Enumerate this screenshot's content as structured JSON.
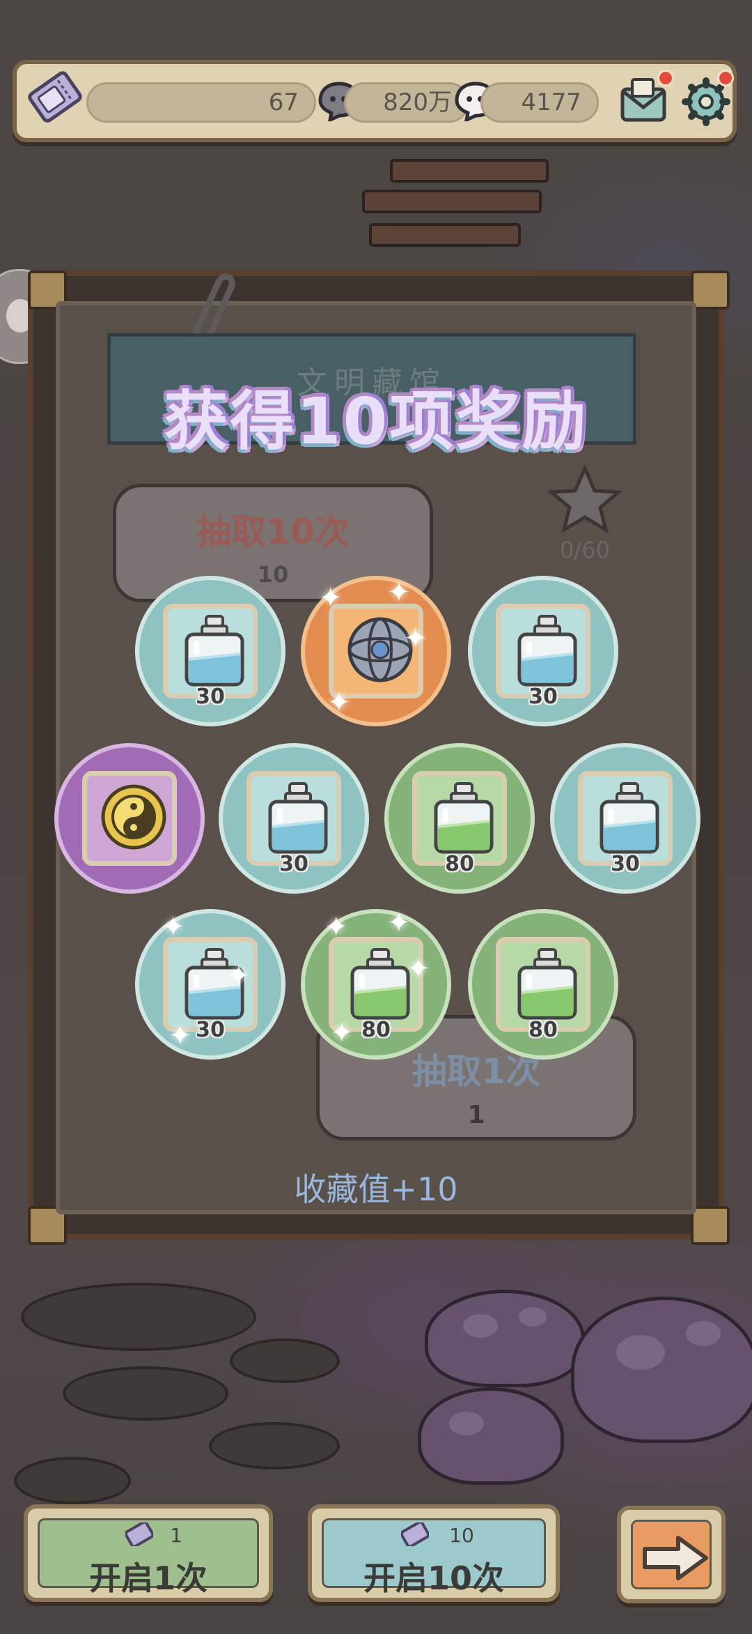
{
  "header": {
    "tickets": "67",
    "ghost_coins": "820万",
    "souls": "4177",
    "mail_icon": "mail-icon",
    "settings_icon": "gear-icon"
  },
  "popup": {
    "title": "获得10项奖励",
    "collection": "收藏值+10"
  },
  "background": {
    "shop_sign": "文明藏馆",
    "draw10_label": "抽取10次",
    "draw10_cost": "10",
    "draw1_label": "抽取1次",
    "draw1_cost": "1",
    "star_progress": "0/60"
  },
  "rewards": [
    {
      "item": "blue-potion",
      "count": "30",
      "rarity": "blue"
    },
    {
      "item": "ornate-orb",
      "count": "",
      "rarity": "orange"
    },
    {
      "item": "blue-potion",
      "count": "30",
      "rarity": "blue"
    },
    {
      "item": "yin-yang-coin",
      "count": "",
      "rarity": "purple"
    },
    {
      "item": "blue-potion",
      "count": "30",
      "rarity": "blue"
    },
    {
      "item": "green-potion",
      "count": "80",
      "rarity": "green"
    },
    {
      "item": "blue-potion",
      "count": "30",
      "rarity": "blue"
    },
    {
      "item": "blue-potion",
      "count": "30",
      "rarity": "blue"
    },
    {
      "item": "green-potion",
      "count": "80",
      "rarity": "green"
    },
    {
      "item": "green-potion",
      "count": "80",
      "rarity": "green"
    }
  ],
  "footer": {
    "open1_cost": "1",
    "open1_label": "开启1次",
    "open10_cost": "10",
    "open10_label": "开启10次",
    "next_icon": "arrow-right-icon"
  },
  "colors": {
    "blue_rarity": "#8ec3c2",
    "green_rarity": "#85b278",
    "purple_rarity": "#a16bb6",
    "orange_rarity": "#e28c4f",
    "title_glow": "#b388c3"
  }
}
